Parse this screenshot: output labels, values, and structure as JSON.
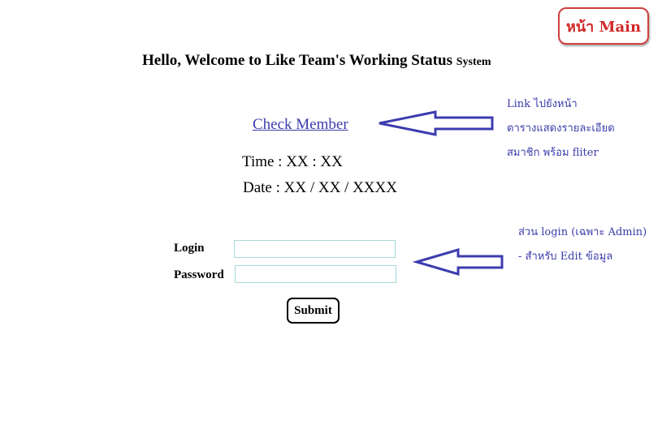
{
  "main_badge": {
    "label": "หน้า Main"
  },
  "header": {
    "title": "Hello, Welcome to Like Team's Working Status",
    "title_suffix": "System"
  },
  "check_member": {
    "label": "Check Member"
  },
  "clock": {
    "time_text": "Time : XX : XX",
    "date_text": "Date : XX / XX / XXXX"
  },
  "login_form": {
    "login_label": "Login",
    "password_label": "Password",
    "login_value": "",
    "password_value": "",
    "submit_label": "Submit"
  },
  "annotations": {
    "link_note": [
      "Link ไปยังหน้า",
      "ตารางแสดงรายละเอียด",
      "สมาชิก พร้อม fliter"
    ],
    "login_note": [
      "ส่วน login (เฉพาะ Admin)",
      "- สำหรับ Edit ข้อมูล"
    ]
  },
  "colors": {
    "annotation": "#3c3caa",
    "badge": "#d02828",
    "input_border": "#a8d8d8"
  }
}
